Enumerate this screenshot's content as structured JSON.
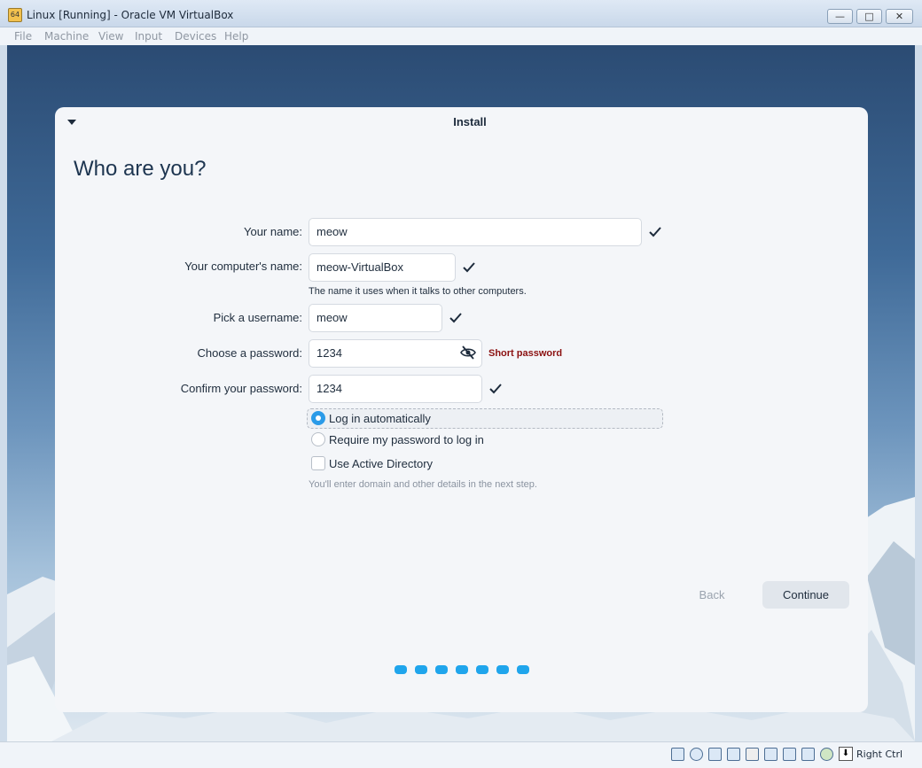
{
  "window": {
    "title": "Linux [Running] - Oracle VM VirtualBox",
    "app_icon": "virtualbox-vm-icon",
    "app_icon_text": "64",
    "controls": {
      "minimize": "—",
      "maximize": "□",
      "close": "✕"
    }
  },
  "menu": [
    "File",
    "Machine",
    "View",
    "Input",
    "Devices",
    "Help"
  ],
  "installer": {
    "header_title": "Install",
    "page_title": "Who are you?",
    "fields": {
      "name": {
        "label": "Your name:",
        "value": "meow"
      },
      "computer": {
        "label": "Your computer's name:",
        "value": "meow-VirtualBox",
        "hint": "The name it uses when it talks to other computers."
      },
      "username": {
        "label": "Pick a username:",
        "value": "meow"
      },
      "password": {
        "label": "Choose a password:",
        "value": "1234",
        "warning": "Short password"
      },
      "confirm": {
        "label": "Confirm your password:",
        "value": "1234"
      }
    },
    "login_options": {
      "auto": {
        "label": "Log in automatically",
        "selected": true
      },
      "require": {
        "label": "Require my password to log in",
        "selected": false
      }
    },
    "active_directory": {
      "label": "Use Active Directory",
      "checked": false,
      "hint": "You'll enter domain and other details in the next step."
    },
    "buttons": {
      "back": "Back",
      "continue": "Continue"
    },
    "progress_steps": 7
  },
  "statusbar": {
    "host_key": "Right Ctrl"
  },
  "colors": {
    "accent": "#2b9be8",
    "warning": "#8b1111",
    "progress_dot": "#1fa5ec"
  }
}
